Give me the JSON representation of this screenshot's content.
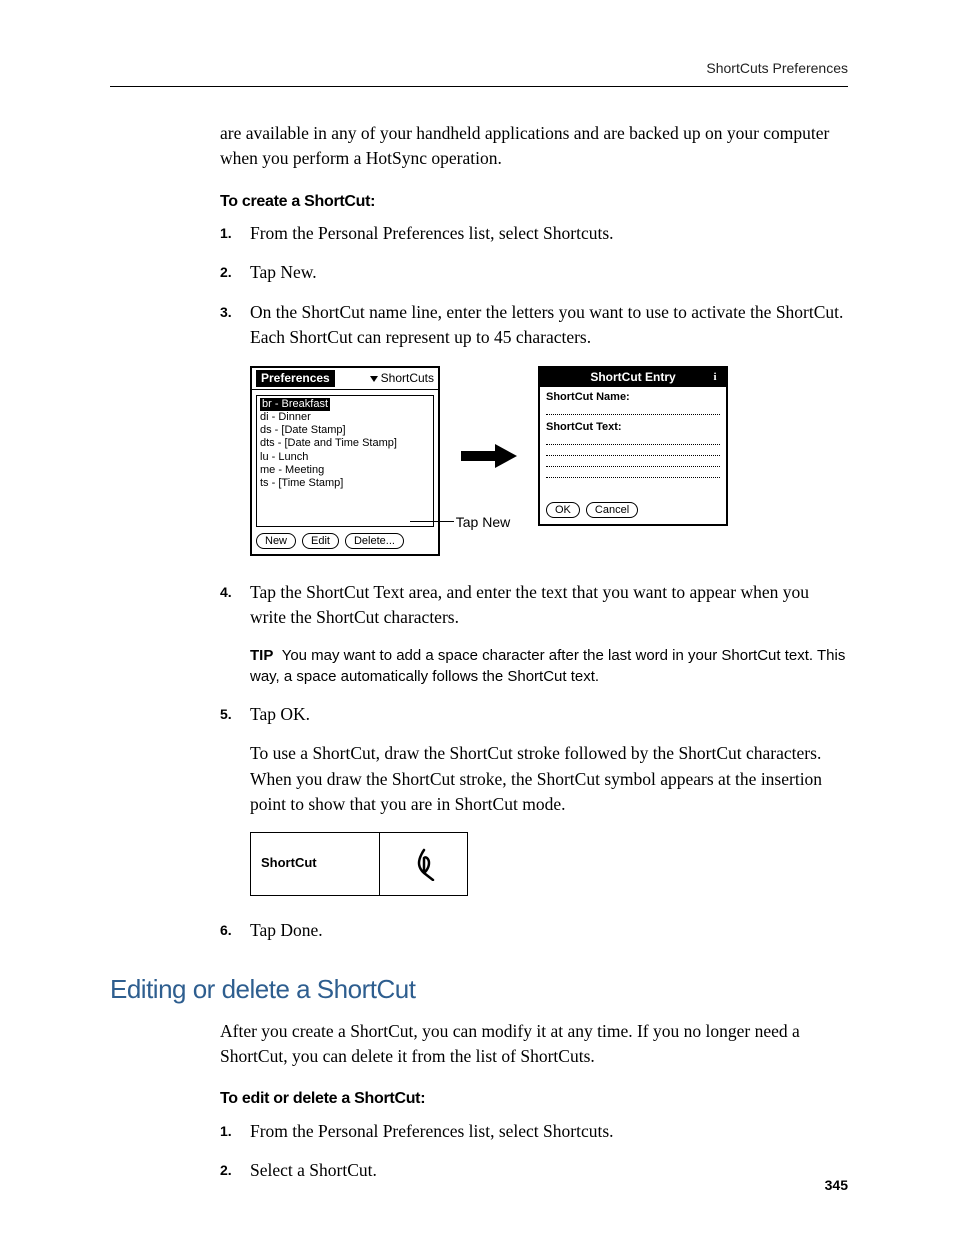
{
  "runningHead": "ShortCuts Preferences",
  "introPara": "are available in any of your handheld applications and are backed up on your computer when you perform a HotSync operation.",
  "procTitle1": "To create a ShortCut:",
  "steps1": {
    "s1": "From the Personal Preferences list, select Shortcuts.",
    "s2": "Tap New.",
    "s3": "On the ShortCut name line, enter the letters you want to use to activate the ShortCut. Each ShortCut can represent up to 45 characters.",
    "s4": "Tap the ShortCut Text area, and enter the text that you want to appear when you write the ShortCut characters.",
    "s5": "Tap OK.",
    "s5follow": "To use a ShortCut, draw the ShortCut stroke followed by the ShortCut characters. When you draw the ShortCut stroke, the ShortCut symbol appears at the insertion point to show that you are in ShortCut mode.",
    "s6": "Tap Done."
  },
  "tip": {
    "label": "TIP",
    "text": "You may want to add a space character after the last word in your ShortCut text. This way, a space automatically follows the ShortCut text."
  },
  "fig": {
    "prefsTitle": "Preferences",
    "prefsMenu": "ShortCuts",
    "list": {
      "i0": "br - Breakfast",
      "i1": "di - Dinner",
      "i2": "ds - [Date Stamp]",
      "i3": "dts - [Date and Time Stamp]",
      "i4": "lu - Lunch",
      "i5": "me - Meeting",
      "i6": "ts - [Time Stamp]"
    },
    "btnNew": "New",
    "btnEdit": "Edit",
    "btnDelete": "Delete...",
    "callout": "Tap New",
    "entryTitle": "ShortCut Entry",
    "entryNameLabel": "ShortCut Name:",
    "entryTextLabel": "ShortCut Text:",
    "btnOK": "OK",
    "btnCancel": "Cancel"
  },
  "scTable": {
    "label": "ShortCut"
  },
  "sectionHeading": "Editing or delete a ShortCut",
  "sectionPara": "After you create a ShortCut, you can modify it at any time. If you no longer need a ShortCut, you can delete it from the list of ShortCuts.",
  "procTitle2": "To edit or delete a ShortCut:",
  "steps2": {
    "s1": "From the Personal Preferences list, select Shortcuts.",
    "s2": "Select a ShortCut."
  },
  "pageNumber": "345"
}
